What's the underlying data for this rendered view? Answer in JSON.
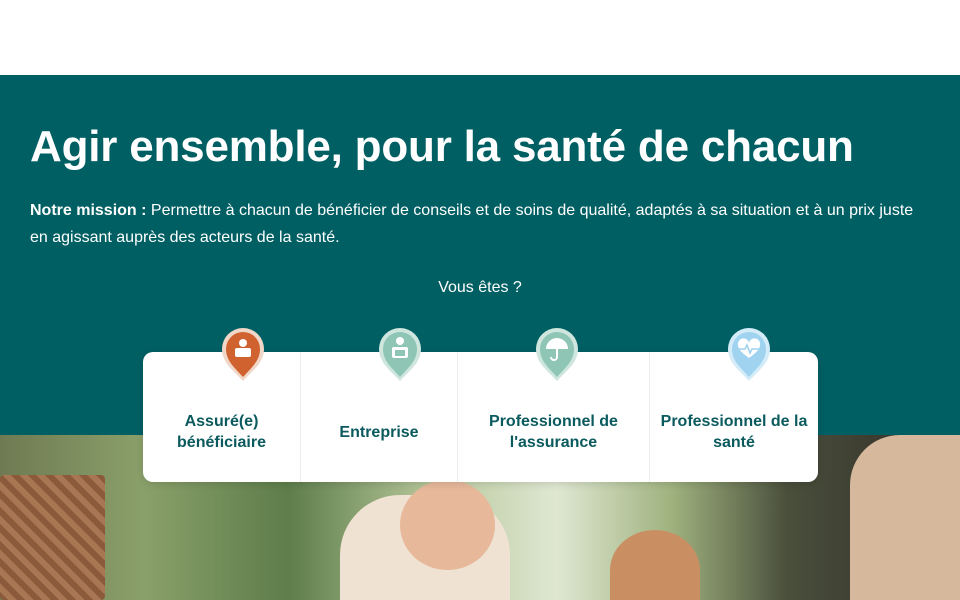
{
  "hero": {
    "title": "Agir ensemble, pour la santé de chacun",
    "mission_label": "Notre mission :",
    "mission_text": " Permettre à chacun de bénéficier de conseils et de soins de qualité, adaptés à sa situation et à un prix juste en agissant auprès des acteurs de la santé.",
    "question": "Vous êtes ?"
  },
  "profiles": [
    {
      "label": "Assuré(e) bénéficiaire",
      "icon": "insured-person-icon",
      "color": "#d0622f"
    },
    {
      "label": "Entreprise",
      "icon": "business-person-icon",
      "color": "#8fc5b4"
    },
    {
      "label": "Professionnel de l'assurance",
      "icon": "umbrella-icon",
      "color": "#8fc5b4"
    },
    {
      "label": "Professionnel de la santé",
      "icon": "heart-pulse-icon",
      "color": "#9fd3f0"
    }
  ],
  "colors": {
    "hero_background": "#005f63",
    "card_text": "#0b5a5e"
  }
}
